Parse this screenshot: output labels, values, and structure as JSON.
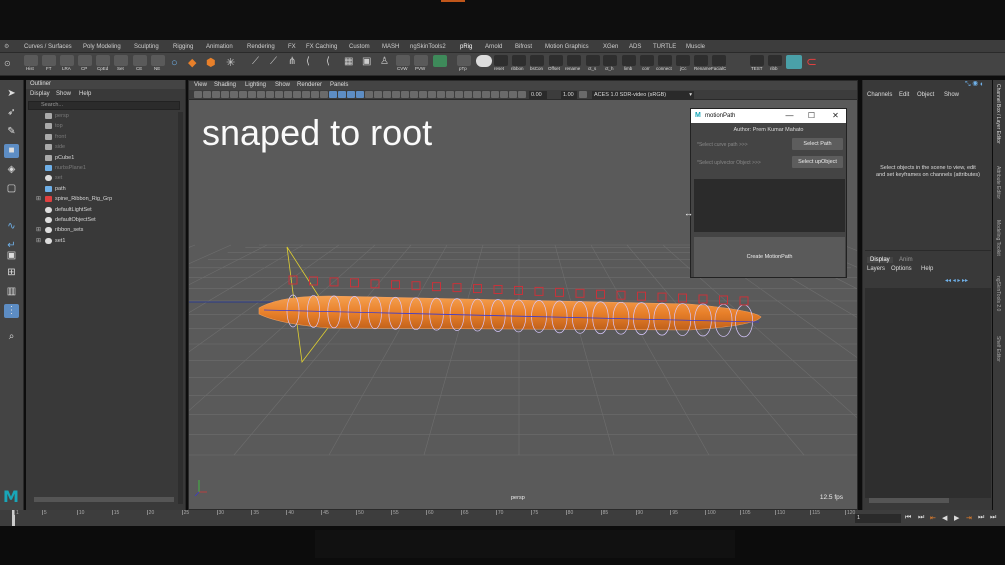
{
  "shelf_tabs": [
    "Curves / Surfaces",
    "Poly Modeling",
    "Sculpting",
    "Rigging",
    "Animation",
    "Rendering",
    "FX",
    "FX Caching",
    "Custom",
    "MASH",
    "ngSkinTools2",
    "pRig",
    "Arnold",
    "Bifrost",
    "Motion Graphics",
    "XGen",
    "ADS",
    "TURTLE",
    "Muscle"
  ],
  "shelf_buttons_left": [
    "Hist",
    "FT",
    "LRA",
    "CP",
    "CpEd",
    "Set",
    "CE",
    "NE"
  ],
  "shelf_buttons_mid": [
    "CVW",
    "PVW"
  ],
  "shelf_buttons_right": [
    "pTp",
    "reset",
    "ribbon",
    "bsCon",
    "Offset",
    "rename",
    "ct_s",
    "ct_h",
    "limb",
    "corr",
    "connect",
    "jCc",
    "Rename",
    "FacialC",
    "TEST",
    "ribb"
  ],
  "outliner": {
    "title": "Outliner",
    "menu": [
      "Display",
      "Show",
      "Help"
    ],
    "search_placeholder": "Search...",
    "items": [
      {
        "label": "persp",
        "dim": true,
        "icon": "camera-icon"
      },
      {
        "label": "top",
        "dim": true,
        "icon": "camera-icon"
      },
      {
        "label": "front",
        "dim": true,
        "icon": "camera-icon"
      },
      {
        "label": "side",
        "dim": true,
        "icon": "camera-icon"
      },
      {
        "label": "pCube1",
        "dim": false,
        "icon": "mesh-icon"
      },
      {
        "label": "nurbsPlane1",
        "dim": true,
        "icon": "nurbs-icon"
      },
      {
        "label": "set",
        "dim": true,
        "icon": "set-icon"
      },
      {
        "label": "path",
        "dim": false,
        "icon": "curve-icon"
      },
      {
        "label": "spine_Ribbon_Rig_Grp",
        "dim": false,
        "icon": "group-icon",
        "expander": "⊞"
      },
      {
        "label": "defaultLightSet",
        "dim": false,
        "icon": "set-icon"
      },
      {
        "label": "defaultObjectSet",
        "dim": false,
        "icon": "set-icon"
      },
      {
        "label": "ribbon_sets",
        "dim": false,
        "icon": "set-icon",
        "expander": "⊞"
      },
      {
        "label": "set1",
        "dim": false,
        "icon": "set-icon",
        "expander": "⊞"
      }
    ]
  },
  "viewport": {
    "menu": [
      "View",
      "Shading",
      "Lighting",
      "Show",
      "Renderer",
      "Panels"
    ],
    "field_1": "0.00",
    "field_2": "1.00",
    "colorspace": "ACES 1.0 SDR-video (sRGB)",
    "overlay_text": "snaped to root",
    "camera": "persp",
    "fps": "12.5 fps"
  },
  "dialog": {
    "title": "motionPath",
    "author": "Author: Prem Kumar Mahato",
    "curve_placeholder": "*Select curve path >>>",
    "curve_button": "Select Path",
    "up_placeholder": "*Select up/vector Object >>>",
    "up_button": "Select upObject",
    "create_button": "Create MotionPath",
    "minimize": "—",
    "maximize": "☐",
    "close": "✕"
  },
  "channel_box": {
    "menu": [
      "Channels",
      "Edit",
      "Object",
      "Show"
    ],
    "message": "Select objects in the scene to view, edit and set keyframes on channels (attributes)",
    "layer_tabs": [
      "Display",
      "Anim"
    ],
    "layer_menu": [
      "Layers",
      "Options",
      "Help"
    ]
  },
  "side_tabs": [
    "Channel Box / Layer Editor",
    "Attribute Editor",
    "Modeling Toolkit",
    "ngSkinTools 2.0",
    "Shelf Editor"
  ],
  "timeline": {
    "ticks": [
      1,
      5,
      10,
      15,
      20,
      25,
      30,
      35,
      40,
      45,
      50,
      55,
      60,
      65,
      70,
      75,
      80,
      85,
      90,
      95,
      100,
      105,
      110,
      115,
      120
    ],
    "current_frame": "1"
  },
  "colors": {
    "accent": "#c0561a",
    "select": "#5d8dc4",
    "ribbon": "#e8802a",
    "control": "#c8323a",
    "joint": "#3a3ad0"
  }
}
